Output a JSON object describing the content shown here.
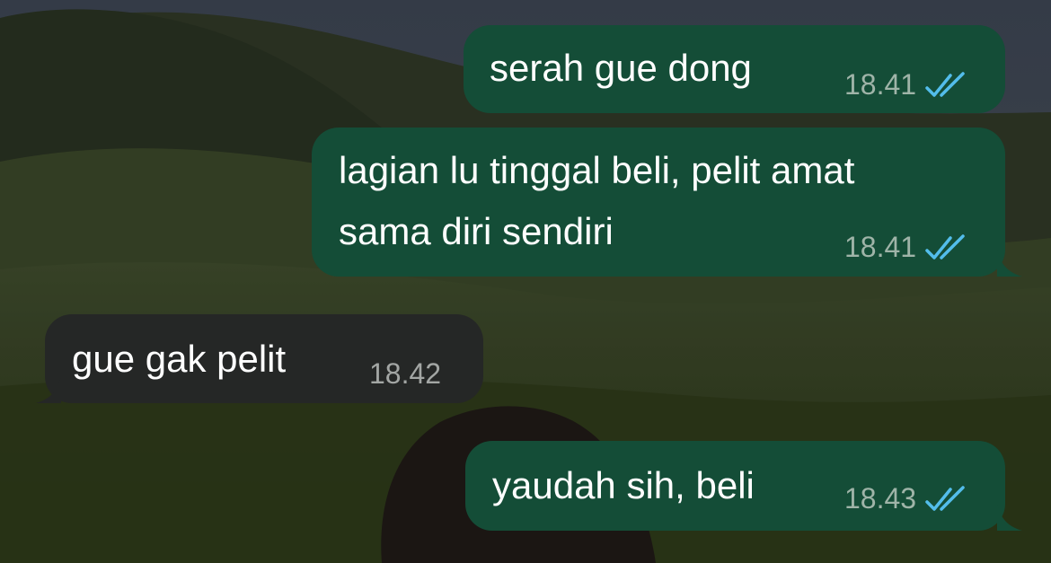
{
  "colors": {
    "outgoing_bubble": "#144d37",
    "incoming_bubble": "#252726",
    "read_ticks": "#53bdeb",
    "outgoing_time": "#9fb4a8",
    "incoming_time": "#a3a6a4"
  },
  "messages": [
    {
      "direction": "out",
      "text": "serah gue dong",
      "time": "18.41",
      "status": "read",
      "status_icon": "double-check-icon"
    },
    {
      "direction": "out",
      "text_lines": [
        "lagian lu tinggal beli, pelit amat",
        "sama diri sendiri"
      ],
      "time": "18.41",
      "status": "read",
      "status_icon": "double-check-icon"
    },
    {
      "direction": "in",
      "text": "gue gak pelit",
      "time": "18.42"
    },
    {
      "direction": "out",
      "text": "yaudah sih, beli",
      "time": "18.43",
      "status": "read",
      "status_icon": "double-check-icon"
    }
  ]
}
